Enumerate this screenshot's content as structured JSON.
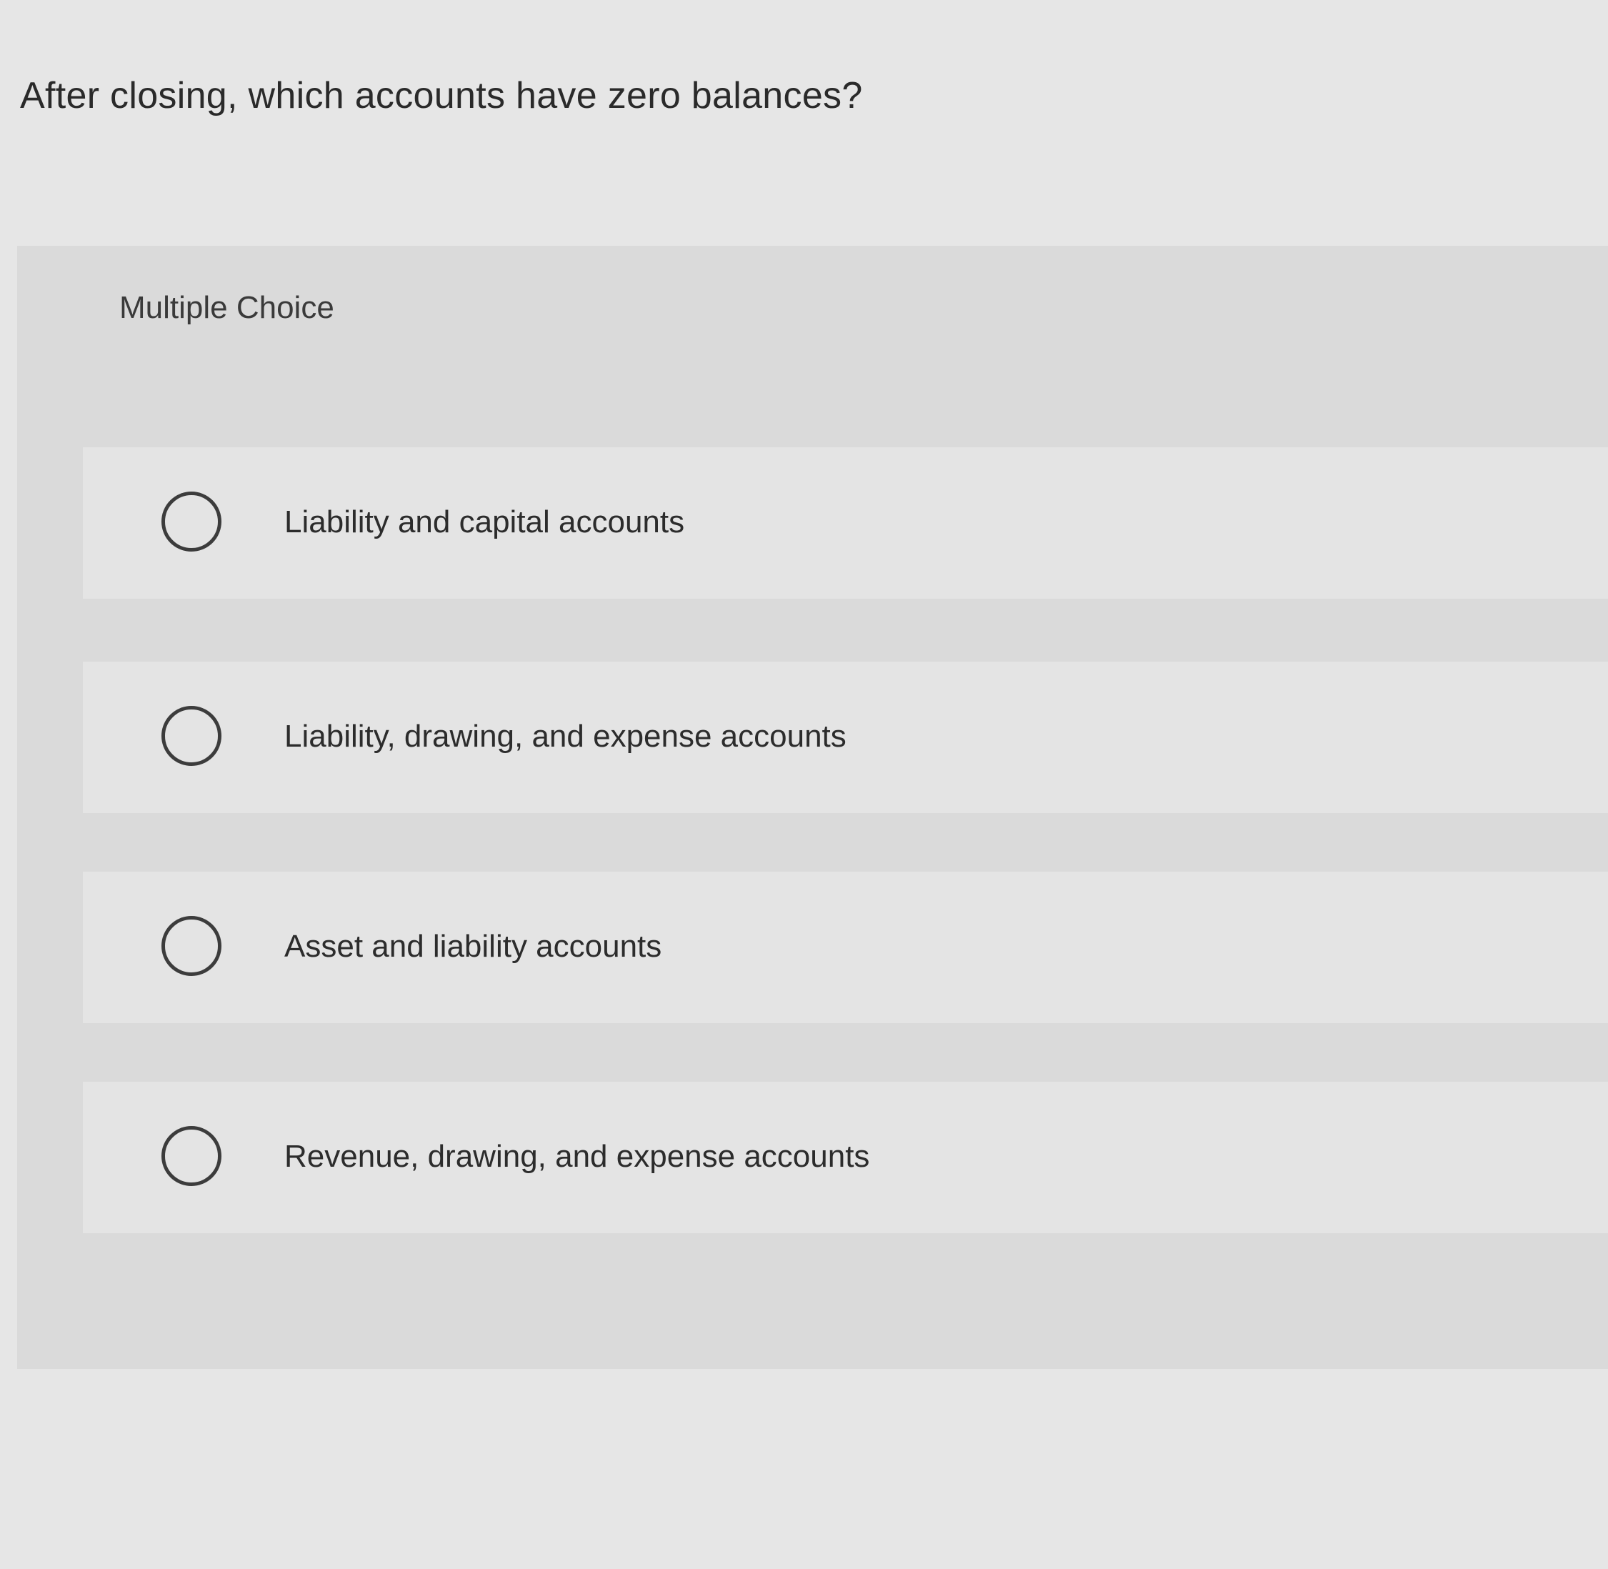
{
  "question": {
    "text": "After closing, which accounts have zero balances?"
  },
  "multiple_choice": {
    "label": "Multiple Choice",
    "options": [
      {
        "label": "Liability and capital accounts",
        "selected": false
      },
      {
        "label": "Liability, drawing, and expense accounts",
        "selected": false
      },
      {
        "label": "Asset and liability accounts",
        "selected": false
      },
      {
        "label": "Revenue, drawing, and expense accounts",
        "selected": false
      }
    ]
  },
  "colors": {
    "page_background": "#e6e6e6",
    "panel_background": "#dadada",
    "option_background": "#e4e4e4",
    "text": "#2c2c2c",
    "radio_border": "#3c3c3c"
  }
}
